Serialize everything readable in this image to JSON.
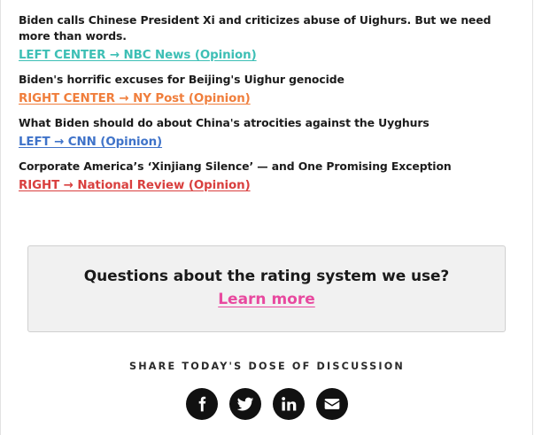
{
  "articles": [
    {
      "headline": "Biden calls Chinese President Xi and criticizes abuse of Uighurs. But we need more than words.",
      "source": "LEFT CENTER → NBC News (Opinion)",
      "color": "#3dbfb5"
    },
    {
      "headline": "Biden's horrific excuses for Beijing's Uighur genocide",
      "source": "RIGHT CENTER → NY Post (Opinion)",
      "color": "#f07e3c"
    },
    {
      "headline": "What Biden should do about China's atrocities against the Uyghurs",
      "source": "LEFT → CNN (Opinion)",
      "color": "#3f73c9"
    },
    {
      "headline": "Corporate America’s ‘Xinjiang Silence’ — and One Promising Exception",
      "source": "RIGHT → National Review (Opinion)",
      "color": "#d9403f"
    }
  ],
  "rating": {
    "question": "Questions about the rating system we use?",
    "link": "Learn more",
    "link_color": "#e8499f"
  },
  "share": {
    "label": "SHARE TODAY'S DOSE OF DISCUSSION",
    "buttons": [
      "facebook-icon",
      "twitter-icon",
      "linkedin-icon",
      "email-icon"
    ]
  }
}
